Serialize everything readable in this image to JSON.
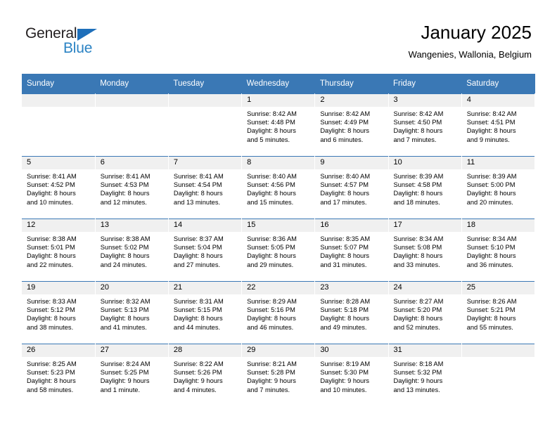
{
  "logo": {
    "word_dark": "General",
    "word_blue": "Blue",
    "triangle_color": "#1e6fba",
    "blue_color": "#2b83c4"
  },
  "header": {
    "title": "January 2025",
    "subtitle": "Wangenies, Wallonia, Belgium"
  },
  "theme": {
    "header_blue": "#3a78b5",
    "daynum_band": "#f0f0f0"
  },
  "weekday_headers": [
    "Sunday",
    "Monday",
    "Tuesday",
    "Wednesday",
    "Thursday",
    "Friday",
    "Saturday"
  ],
  "weeks": [
    [
      {
        "day": "",
        "sunrise": "",
        "sunset": "",
        "daylight_1": "",
        "daylight_2": ""
      },
      {
        "day": "",
        "sunrise": "",
        "sunset": "",
        "daylight_1": "",
        "daylight_2": ""
      },
      {
        "day": "",
        "sunrise": "",
        "sunset": "",
        "daylight_1": "",
        "daylight_2": ""
      },
      {
        "day": "1",
        "sunrise": "Sunrise: 8:42 AM",
        "sunset": "Sunset: 4:48 PM",
        "daylight_1": "Daylight: 8 hours",
        "daylight_2": "and 5 minutes."
      },
      {
        "day": "2",
        "sunrise": "Sunrise: 8:42 AM",
        "sunset": "Sunset: 4:49 PM",
        "daylight_1": "Daylight: 8 hours",
        "daylight_2": "and 6 minutes."
      },
      {
        "day": "3",
        "sunrise": "Sunrise: 8:42 AM",
        "sunset": "Sunset: 4:50 PM",
        "daylight_1": "Daylight: 8 hours",
        "daylight_2": "and 7 minutes."
      },
      {
        "day": "4",
        "sunrise": "Sunrise: 8:42 AM",
        "sunset": "Sunset: 4:51 PM",
        "daylight_1": "Daylight: 8 hours",
        "daylight_2": "and 9 minutes."
      }
    ],
    [
      {
        "day": "5",
        "sunrise": "Sunrise: 8:41 AM",
        "sunset": "Sunset: 4:52 PM",
        "daylight_1": "Daylight: 8 hours",
        "daylight_2": "and 10 minutes."
      },
      {
        "day": "6",
        "sunrise": "Sunrise: 8:41 AM",
        "sunset": "Sunset: 4:53 PM",
        "daylight_1": "Daylight: 8 hours",
        "daylight_2": "and 12 minutes."
      },
      {
        "day": "7",
        "sunrise": "Sunrise: 8:41 AM",
        "sunset": "Sunset: 4:54 PM",
        "daylight_1": "Daylight: 8 hours",
        "daylight_2": "and 13 minutes."
      },
      {
        "day": "8",
        "sunrise": "Sunrise: 8:40 AM",
        "sunset": "Sunset: 4:56 PM",
        "daylight_1": "Daylight: 8 hours",
        "daylight_2": "and 15 minutes."
      },
      {
        "day": "9",
        "sunrise": "Sunrise: 8:40 AM",
        "sunset": "Sunset: 4:57 PM",
        "daylight_1": "Daylight: 8 hours",
        "daylight_2": "and 17 minutes."
      },
      {
        "day": "10",
        "sunrise": "Sunrise: 8:39 AM",
        "sunset": "Sunset: 4:58 PM",
        "daylight_1": "Daylight: 8 hours",
        "daylight_2": "and 18 minutes."
      },
      {
        "day": "11",
        "sunrise": "Sunrise: 8:39 AM",
        "sunset": "Sunset: 5:00 PM",
        "daylight_1": "Daylight: 8 hours",
        "daylight_2": "and 20 minutes."
      }
    ],
    [
      {
        "day": "12",
        "sunrise": "Sunrise: 8:38 AM",
        "sunset": "Sunset: 5:01 PM",
        "daylight_1": "Daylight: 8 hours",
        "daylight_2": "and 22 minutes."
      },
      {
        "day": "13",
        "sunrise": "Sunrise: 8:38 AM",
        "sunset": "Sunset: 5:02 PM",
        "daylight_1": "Daylight: 8 hours",
        "daylight_2": "and 24 minutes."
      },
      {
        "day": "14",
        "sunrise": "Sunrise: 8:37 AM",
        "sunset": "Sunset: 5:04 PM",
        "daylight_1": "Daylight: 8 hours",
        "daylight_2": "and 27 minutes."
      },
      {
        "day": "15",
        "sunrise": "Sunrise: 8:36 AM",
        "sunset": "Sunset: 5:05 PM",
        "daylight_1": "Daylight: 8 hours",
        "daylight_2": "and 29 minutes."
      },
      {
        "day": "16",
        "sunrise": "Sunrise: 8:35 AM",
        "sunset": "Sunset: 5:07 PM",
        "daylight_1": "Daylight: 8 hours",
        "daylight_2": "and 31 minutes."
      },
      {
        "day": "17",
        "sunrise": "Sunrise: 8:34 AM",
        "sunset": "Sunset: 5:08 PM",
        "daylight_1": "Daylight: 8 hours",
        "daylight_2": "and 33 minutes."
      },
      {
        "day": "18",
        "sunrise": "Sunrise: 8:34 AM",
        "sunset": "Sunset: 5:10 PM",
        "daylight_1": "Daylight: 8 hours",
        "daylight_2": "and 36 minutes."
      }
    ],
    [
      {
        "day": "19",
        "sunrise": "Sunrise: 8:33 AM",
        "sunset": "Sunset: 5:12 PM",
        "daylight_1": "Daylight: 8 hours",
        "daylight_2": "and 38 minutes."
      },
      {
        "day": "20",
        "sunrise": "Sunrise: 8:32 AM",
        "sunset": "Sunset: 5:13 PM",
        "daylight_1": "Daylight: 8 hours",
        "daylight_2": "and 41 minutes."
      },
      {
        "day": "21",
        "sunrise": "Sunrise: 8:31 AM",
        "sunset": "Sunset: 5:15 PM",
        "daylight_1": "Daylight: 8 hours",
        "daylight_2": "and 44 minutes."
      },
      {
        "day": "22",
        "sunrise": "Sunrise: 8:29 AM",
        "sunset": "Sunset: 5:16 PM",
        "daylight_1": "Daylight: 8 hours",
        "daylight_2": "and 46 minutes."
      },
      {
        "day": "23",
        "sunrise": "Sunrise: 8:28 AM",
        "sunset": "Sunset: 5:18 PM",
        "daylight_1": "Daylight: 8 hours",
        "daylight_2": "and 49 minutes."
      },
      {
        "day": "24",
        "sunrise": "Sunrise: 8:27 AM",
        "sunset": "Sunset: 5:20 PM",
        "daylight_1": "Daylight: 8 hours",
        "daylight_2": "and 52 minutes."
      },
      {
        "day": "25",
        "sunrise": "Sunrise: 8:26 AM",
        "sunset": "Sunset: 5:21 PM",
        "daylight_1": "Daylight: 8 hours",
        "daylight_2": "and 55 minutes."
      }
    ],
    [
      {
        "day": "26",
        "sunrise": "Sunrise: 8:25 AM",
        "sunset": "Sunset: 5:23 PM",
        "daylight_1": "Daylight: 8 hours",
        "daylight_2": "and 58 minutes."
      },
      {
        "day": "27",
        "sunrise": "Sunrise: 8:24 AM",
        "sunset": "Sunset: 5:25 PM",
        "daylight_1": "Daylight: 9 hours",
        "daylight_2": "and 1 minute."
      },
      {
        "day": "28",
        "sunrise": "Sunrise: 8:22 AM",
        "sunset": "Sunset: 5:26 PM",
        "daylight_1": "Daylight: 9 hours",
        "daylight_2": "and 4 minutes."
      },
      {
        "day": "29",
        "sunrise": "Sunrise: 8:21 AM",
        "sunset": "Sunset: 5:28 PM",
        "daylight_1": "Daylight: 9 hours",
        "daylight_2": "and 7 minutes."
      },
      {
        "day": "30",
        "sunrise": "Sunrise: 8:19 AM",
        "sunset": "Sunset: 5:30 PM",
        "daylight_1": "Daylight: 9 hours",
        "daylight_2": "and 10 minutes."
      },
      {
        "day": "31",
        "sunrise": "Sunrise: 8:18 AM",
        "sunset": "Sunset: 5:32 PM",
        "daylight_1": "Daylight: 9 hours",
        "daylight_2": "and 13 minutes."
      },
      {
        "day": "",
        "sunrise": "",
        "sunset": "",
        "daylight_1": "",
        "daylight_2": ""
      }
    ]
  ]
}
